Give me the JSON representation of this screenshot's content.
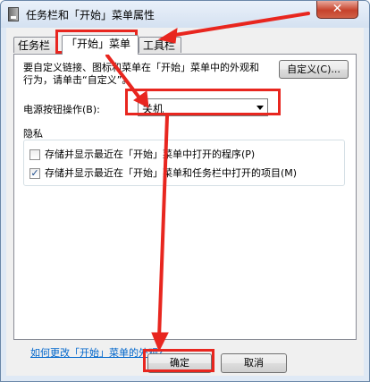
{
  "window": {
    "title": "任务栏和「开始」菜单属性",
    "close_glyph": "✕"
  },
  "tabs": [
    {
      "label": "任务栏"
    },
    {
      "label": "「开始」菜单"
    },
    {
      "label": "工具栏"
    }
  ],
  "main": {
    "description": "要自定义链接、图标和菜单在「开始」菜单中的外观和行为，请单击“自定义”。",
    "customize_button": "自定义(C)...",
    "power_label": "电源按钮操作(B):",
    "power_value": "关机",
    "privacy_label": "隐私",
    "privacy_options": [
      {
        "label": "存储并显示最近在「开始」菜单中打开的程序(P)",
        "checked": false
      },
      {
        "label": "存储并显示最近在「开始」菜单和任务栏中打开的项目(M)",
        "checked": true
      }
    ],
    "help_link": "如何更改「开始」菜单的外观?"
  },
  "footer": {
    "ok_button": "确定",
    "cancel_button": "取消"
  },
  "colors": {
    "highlight": "#e8261f",
    "link": "#0066cc"
  }
}
